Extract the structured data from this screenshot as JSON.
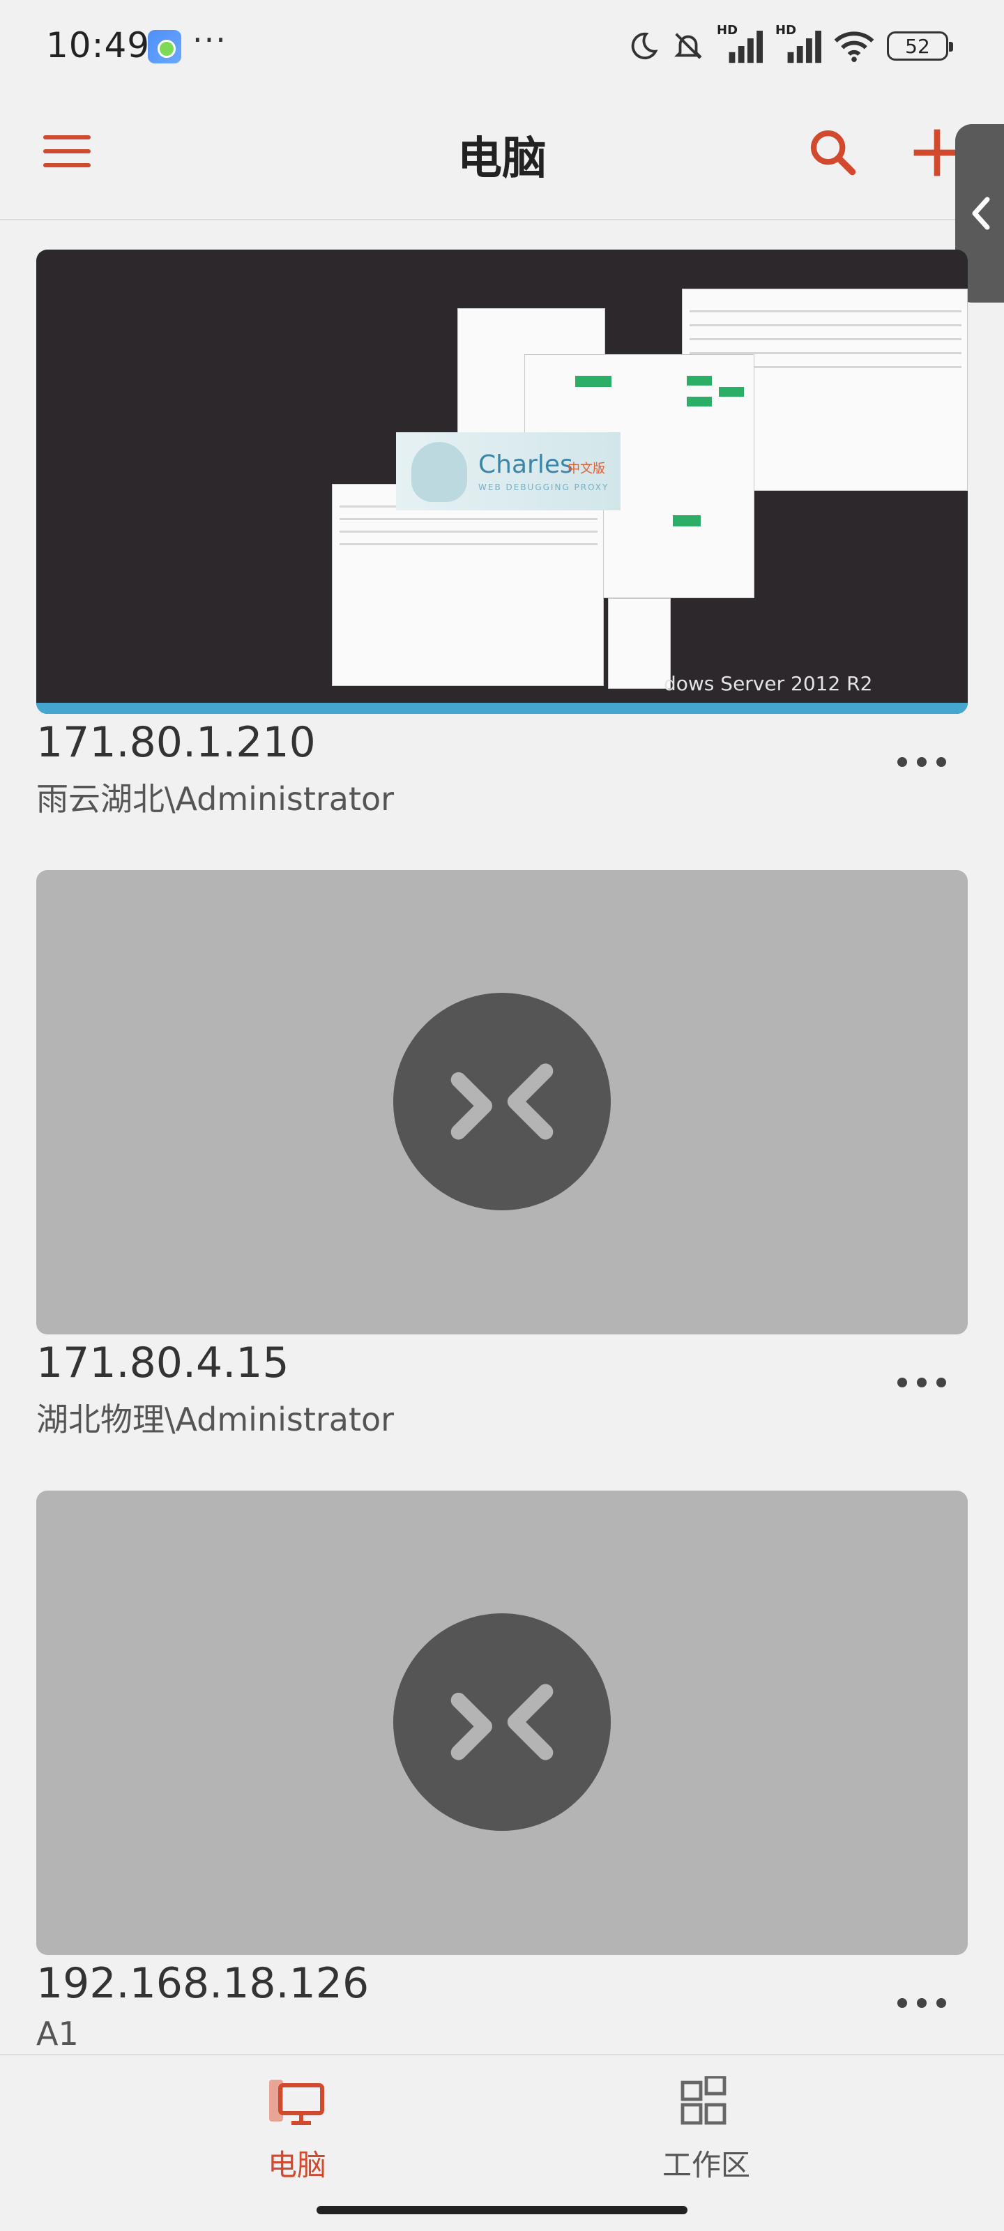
{
  "status_bar": {
    "time": "10:49",
    "more": "···",
    "battery": "52",
    "signal_label_1": "HD",
    "signal_label_2": "HD"
  },
  "header": {
    "title": "电脑"
  },
  "connections": [
    {
      "host": "171.80.1.210",
      "user": "雨云湖北\\Administrator",
      "thumbnail_os_label": "dows Server 2012 R2",
      "thumbnail_app_title": "Charles",
      "thumbnail_app_subtitle": "WEB DEBUGGING PROXY",
      "thumbnail_app_badge": "中文版"
    },
    {
      "host": "171.80.4.15",
      "user": "湖北物理\\Administrator"
    },
    {
      "host": "192.168.18.126",
      "user": "A1"
    }
  ],
  "bottom_nav": {
    "items": [
      {
        "label": "电脑",
        "icon": "computer-icon",
        "active": true
      },
      {
        "label": "工作区",
        "icon": "workspaces-icon",
        "active": false
      }
    ]
  },
  "colors": {
    "accent": "#d14a2e",
    "placeholder": "#b4b4b4",
    "logo_circle": "#555555"
  }
}
